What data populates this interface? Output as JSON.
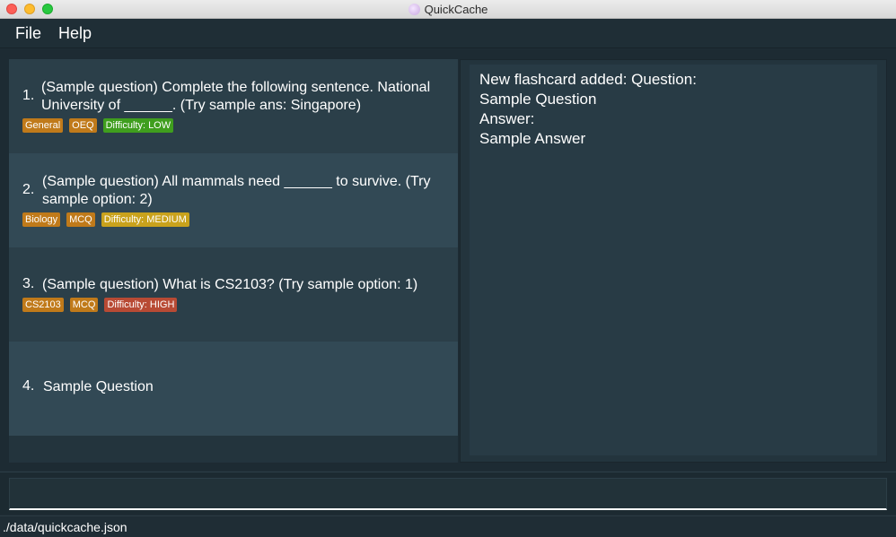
{
  "window": {
    "title": "QuickCache"
  },
  "menu": {
    "items": [
      {
        "label": "File"
      },
      {
        "label": "Help"
      }
    ]
  },
  "flashcards": [
    {
      "index": "1.",
      "question": "(Sample question) Complete the following sentence. National University of ______. (Try sample ans: Singapore)",
      "tags": [
        {
          "label": "General",
          "color": "#c07a1a"
        },
        {
          "label": "OEQ",
          "color": "#c07a1a"
        },
        {
          "label": "Difficulty: LOW",
          "color": "#3f9e1e"
        }
      ]
    },
    {
      "index": "2.",
      "question": "(Sample question) All mammals need ______ to survive. (Try sample option: 2)",
      "tags": [
        {
          "label": "Biology",
          "color": "#c07a1a"
        },
        {
          "label": "MCQ",
          "color": "#c07a1a"
        },
        {
          "label": "Difficulty: MEDIUM",
          "color": "#c9a21c"
        }
      ]
    },
    {
      "index": "3.",
      "question": "(Sample question) What is CS2103? (Try sample option: 1)",
      "tags": [
        {
          "label": "CS2103",
          "color": "#c07a1a"
        },
        {
          "label": "MCQ",
          "color": "#c07a1a"
        },
        {
          "label": "Difficulty: HIGH",
          "color": "#b84a34"
        }
      ]
    },
    {
      "index": "4.",
      "question": "Sample Question",
      "tags": []
    }
  ],
  "result": {
    "lines": [
      "New flashcard added: Question:",
      "Sample Question",
      "Answer:",
      "Sample Answer"
    ]
  },
  "command": {
    "value": "",
    "placeholder": ""
  },
  "status": {
    "path": "./data/quickcache.json"
  }
}
